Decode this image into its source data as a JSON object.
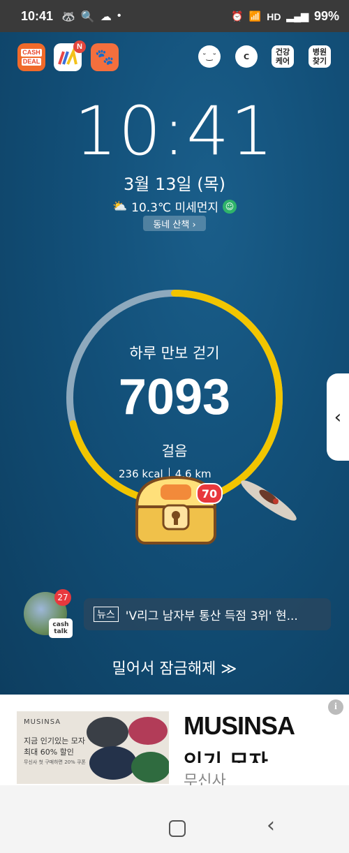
{
  "status_bar": {
    "time": "10:41",
    "icons": [
      "🦝",
      "🔍",
      "☁",
      "•"
    ],
    "right_icons": [
      "⏰",
      "📶",
      "HD",
      "▂▄▆"
    ],
    "battery": "99%"
  },
  "apps": {
    "cash_deal": {
      "line1": "CASH",
      "line2": "DEAL"
    },
    "cash_talk": {
      "badge": "N"
    },
    "pet": {
      "glyph": "🐾"
    }
  },
  "top_buttons": {
    "face": "˘‿˘",
    "coin": "C",
    "health": "건강\n케어",
    "hospital": "병원\n찾기"
  },
  "clock": "10:41",
  "date": "3월 13일 (목)",
  "weather": {
    "icon": "⛅",
    "text": "10.3℃ 미세먼지"
  },
  "walk_chip": "동네 산책 ›",
  "walk": {
    "title": "하루 만보 걷기",
    "steps": "7093",
    "unit": "걸음",
    "kcal": "236 kcal",
    "km": "4.6 km",
    "progress": 0.71
  },
  "chest_badge": "70",
  "side_tab_icon": "‹",
  "talk": {
    "badge": "27",
    "label": "cash\ntalk"
  },
  "news": {
    "tag": "뉴스",
    "text": "'V리그 남자부 통산 득점 3위' 현..."
  },
  "unlock": "밀어서 잠금해제 ≫",
  "ad": {
    "img_brand": "MUSINSA",
    "img_line1": "지금 인기있는 모자",
    "img_line2": "최대 60% 할인",
    "img_line3": "무신사 첫 구매하면 20% 쿠폰",
    "title": "MUSINSA",
    "subtitle": "인기 모자",
    "brand": "무신사",
    "info_icon": "i"
  }
}
